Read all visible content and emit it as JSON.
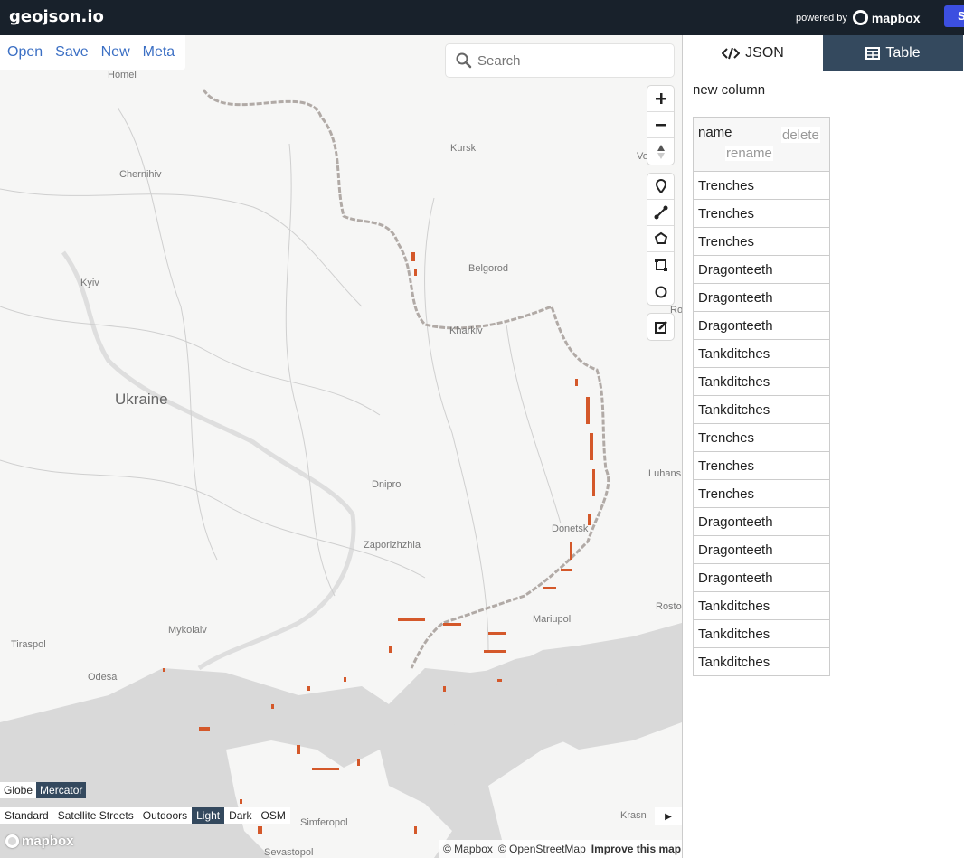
{
  "app": {
    "title": "geojson.io",
    "powered_by": "powered by",
    "mapbox": "mapbox",
    "signin": "S"
  },
  "file_menu": [
    "Open",
    "Save",
    "New",
    "Meta"
  ],
  "search": {
    "placeholder": "Search"
  },
  "panel": {
    "tabs": [
      {
        "label": "JSON",
        "icon": "code-icon"
      },
      {
        "label": "Table",
        "icon": "table-icon"
      }
    ],
    "new_column": "new column",
    "column": {
      "name": "name",
      "delete": "delete",
      "rename": "rename"
    },
    "rows": [
      "Trenches",
      "Trenches",
      "Trenches",
      "Dragonteeth",
      "Dragonteeth",
      "Dragonteeth",
      "Tankditches",
      "Tankditches",
      "Tankditches",
      "Trenches",
      "Trenches",
      "Trenches",
      "Dragonteeth",
      "Dragonteeth",
      "Dragonteeth",
      "Tankditches",
      "Tankditches",
      "Tankditches"
    ]
  },
  "map": {
    "labels": {
      "homel": "Homel",
      "kursk": "Kursk",
      "voronezh": "Vo",
      "chernihiv": "Chernihiv",
      "belgorod": "Belgorod",
      "kyiv": "Kyiv",
      "kharkiv": "Kharkiv",
      "ukraine": "Ukraine",
      "dnipro": "Dnipro",
      "luhansk": "Luhans",
      "donetsk": "Donetsk",
      "zaporizhzhia": "Zaporizhzhia",
      "rostov": "Rosto",
      "mariupol": "Mariupol",
      "mykolaiv": "Mykolaiv",
      "tiraspol": "Tiraspol",
      "odesa": "Odesa",
      "simferopol": "Simferopol",
      "sevastopol": "Sevastopol",
      "krasnodar": "Krasn",
      "rossosh": "Ros"
    },
    "colors": {
      "land": "#f6f6f5",
      "water": "#d9d9d9",
      "border": "#b1aaa6",
      "feature": "#d4582a"
    }
  },
  "projection": {
    "options": [
      "Globe",
      "Mercator"
    ],
    "active": "Mercator"
  },
  "styles": {
    "options": [
      "Standard",
      "Satellite Streets",
      "Outdoors",
      "Light",
      "Dark",
      "OSM"
    ],
    "active": "Light"
  },
  "attribution": {
    "mapbox": "© Mapbox",
    "osm": "© OpenStreetMap",
    "improve": "Improve this map"
  },
  "mapbox_logo": "mapbox"
}
